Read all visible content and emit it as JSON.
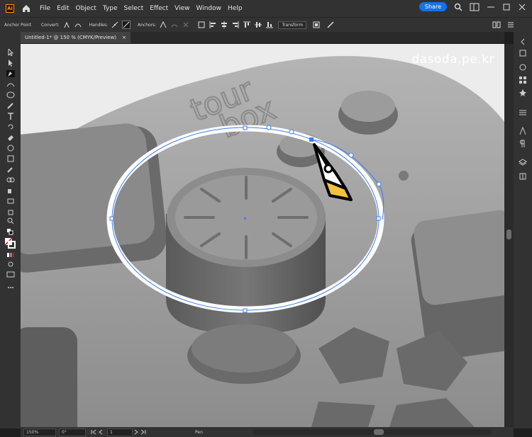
{
  "app": {
    "logo": "Ai",
    "menus": [
      "File",
      "Edit",
      "Object",
      "Type",
      "Select",
      "Effect",
      "View",
      "Window",
      "Help"
    ],
    "share_label": "Share"
  },
  "control_bar": {
    "anchor_point": "Anchor Point",
    "convert": "Convert:",
    "handles": "Handles:",
    "anchors": "Anchors:",
    "transform": "Transform"
  },
  "document": {
    "tab_title": "Untitled-1* @ 150 % (CMYK/Preview)",
    "close": "×"
  },
  "canvas": {
    "watermark": "dasoda.pe.kr",
    "logo_text_1": "tour",
    "logo_text_2": "box"
  },
  "status": {
    "zoom": "150%",
    "rotation": "0°",
    "artboard": "1",
    "tool": "Pen"
  },
  "colors": {
    "accent": "#1473e6",
    "path_blue": "#3d7df2",
    "pen_yellow": "#f4c13a"
  }
}
